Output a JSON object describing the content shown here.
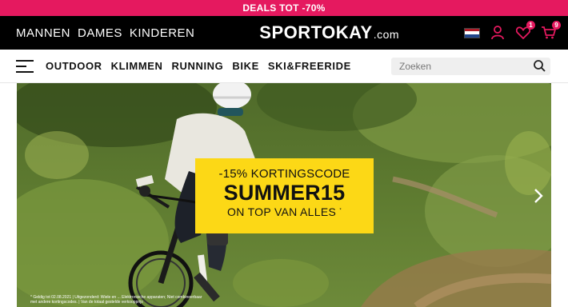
{
  "promo_bar": {
    "text": "DEALS TOT -70%"
  },
  "header": {
    "gender_nav": [
      "MANNEN",
      "DAMES",
      "KINDEREN"
    ],
    "logo": {
      "main": "SPORTOKAY",
      "suffix": ".com"
    },
    "icons": {
      "flag": "netherlands-flag-icon",
      "account": "user-icon",
      "wishlist": "heart-icon",
      "cart": "cart-icon"
    },
    "wishlist_count": "1",
    "cart_count": "9"
  },
  "category_nav": {
    "items": [
      "OUTDOOR",
      "KLIMMEN",
      "RUNNING",
      "BIKE",
      "SKI&FREERIDE"
    ]
  },
  "search": {
    "placeholder": "Zoeken"
  },
  "hero": {
    "promo_line1": "-15% KORTINGSCODE",
    "promo_code": "SUMMER15",
    "promo_line3": "ON TOP VAN ALLES",
    "promo_asterisk": "*",
    "disclaimer": "* Geldig tot 02.08.2021 | Uitgezonderd: Wiele en ... Elektronische apparaten; Niet combineerbaar met andere kortingscodes. | Van de totaal gestelde verkoopprijs",
    "next_icon": "chevron-right-icon"
  },
  "colors": {
    "accent": "#e5195f",
    "topbar": "#000000",
    "promo_box": "#fcd816"
  }
}
